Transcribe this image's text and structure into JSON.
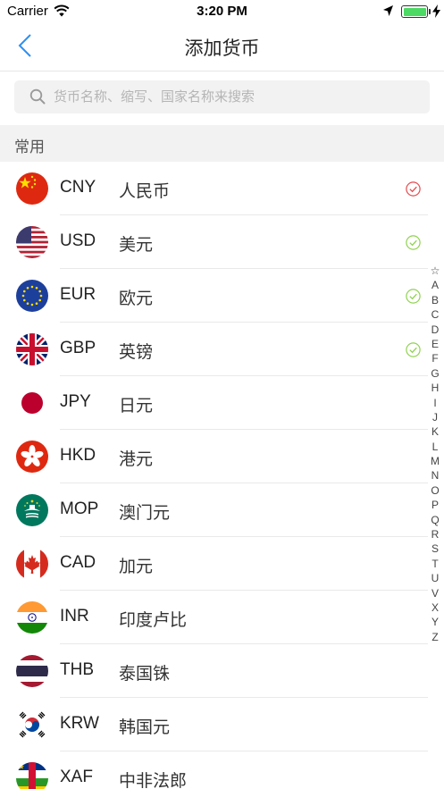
{
  "status_bar": {
    "carrier": "Carrier",
    "time": "3:20 PM",
    "battery_level": 1.0
  },
  "nav": {
    "title": "添加货币"
  },
  "search": {
    "placeholder": "货币名称、缩写、国家名称来搜索",
    "value": ""
  },
  "section": {
    "title": "常用"
  },
  "currencies": [
    {
      "code": "CNY",
      "name": "人民币",
      "flag_icon": "china-flag-icon",
      "checked": true,
      "check_color": "#e5484d"
    },
    {
      "code": "USD",
      "name": "美元",
      "flag_icon": "usa-flag-icon",
      "checked": true,
      "check_color": "#8fd14f"
    },
    {
      "code": "EUR",
      "name": "欧元",
      "flag_icon": "eu-flag-icon",
      "checked": true,
      "check_color": "#8fd14f"
    },
    {
      "code": "GBP",
      "name": "英镑",
      "flag_icon": "uk-flag-icon",
      "checked": true,
      "check_color": "#8fd14f"
    },
    {
      "code": "JPY",
      "name": "日元",
      "flag_icon": "japan-flag-icon",
      "checked": false
    },
    {
      "code": "HKD",
      "name": "港元",
      "flag_icon": "hong-kong-flag-icon",
      "checked": false
    },
    {
      "code": "MOP",
      "name": "澳门元",
      "flag_icon": "macau-flag-icon",
      "checked": false
    },
    {
      "code": "CAD",
      "name": "加元",
      "flag_icon": "canada-flag-icon",
      "checked": false
    },
    {
      "code": "INR",
      "name": "印度卢比",
      "flag_icon": "india-flag-icon",
      "checked": false
    },
    {
      "code": "THB",
      "name": "泰国铢",
      "flag_icon": "thailand-flag-icon",
      "checked": false
    },
    {
      "code": "KRW",
      "name": "韩国元",
      "flag_icon": "south-korea-flag-icon",
      "checked": false
    },
    {
      "code": "XAF",
      "name": "中非法郎",
      "flag_icon": "central-african-flag-icon",
      "checked": false
    }
  ],
  "index_letters": [
    "☆",
    "A",
    "B",
    "C",
    "D",
    "E",
    "F",
    "G",
    "H",
    "I",
    "J",
    "K",
    "L",
    "M",
    "N",
    "O",
    "P",
    "Q",
    "R",
    "S",
    "T",
    "U",
    "V",
    "X",
    "Y",
    "Z"
  ],
  "colors": {
    "accent": "#2f8ff0",
    "check_selected_red": "#e5484d",
    "check_green": "#8fd14f"
  }
}
